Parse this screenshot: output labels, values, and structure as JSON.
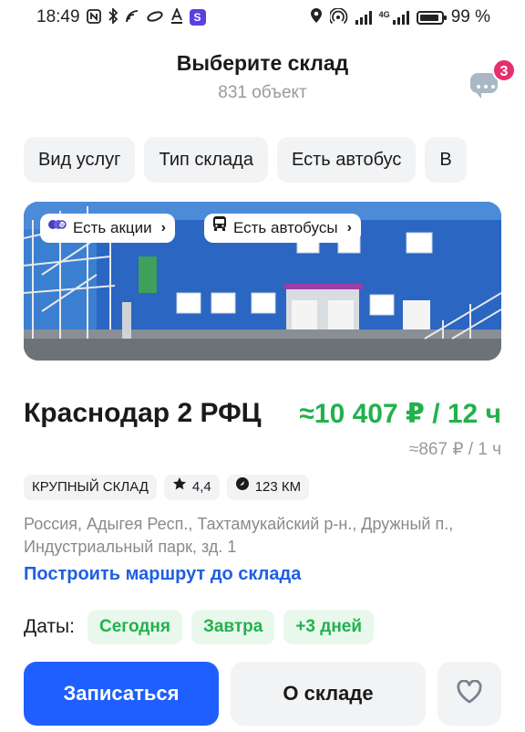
{
  "status_bar": {
    "time": "18:49",
    "left_icons": [
      "nfc-icon",
      "bluetooth-icon",
      "wifi-calling-icon",
      "sync-icon",
      "font-icon",
      "app-s-icon"
    ],
    "right_icons": [
      "location-icon",
      "hotspot-icon",
      "signal-icon",
      "signal-4g-icon",
      "battery-icon"
    ],
    "network_label": "4G",
    "battery": "99 %"
  },
  "header": {
    "title": "Выберите склад",
    "subtitle": "831 объект",
    "chat_badge": "3"
  },
  "filters": [
    "Вид услуг",
    "Тип склада",
    "Есть автобус",
    "В"
  ],
  "card": {
    "tags": [
      {
        "label": "Есть акции",
        "icon": "promo-icon"
      },
      {
        "label": "Есть автобусы",
        "icon": "bus-icon"
      }
    ],
    "title": "Краснодар 2 РФЦ",
    "price_main": "≈10 407 ₽ / 12 ч",
    "price_hour": "≈867 ₽ / 1 ч",
    "meta": {
      "type": "КРУПНЫЙ СКЛАД",
      "rating": "4,4",
      "distance": "123 КМ"
    },
    "address": "Россия, Адыгея Респ., Тахтамукайский р-н., Дружный п., Индустриальный парк, зд. 1",
    "route_link": "Построить маршрут до склада",
    "dates_label": "Даты:",
    "dates": [
      "Сегодня",
      "Завтра",
      "+3 дней"
    ],
    "primary_button": "Записаться",
    "secondary_button": "О складе"
  },
  "colors": {
    "accent_blue": "#1f5fff",
    "link_blue": "#1f5fe0",
    "price_green": "#22b14c",
    "badge_pink": "#e5306f",
    "chip_bg": "#f2f3f5"
  }
}
